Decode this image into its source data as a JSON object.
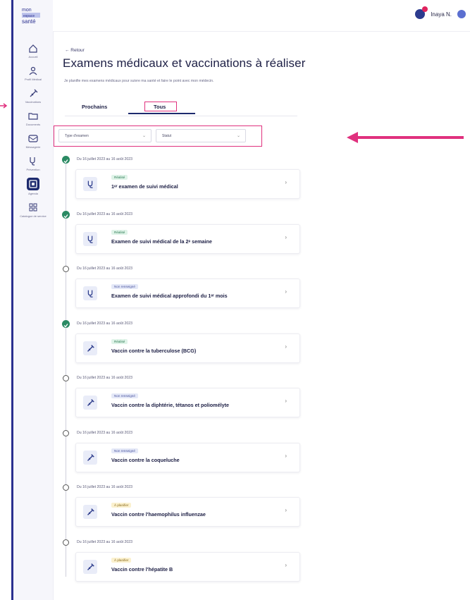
{
  "app": {
    "logo_text": [
      "mon",
      "espace",
      "santé"
    ],
    "user_name": "Inaya N."
  },
  "sidebar": {
    "items": [
      {
        "label": "Accueil",
        "icon": "home-icon"
      },
      {
        "label": "Profil Médical",
        "icon": "profile-icon"
      },
      {
        "label": "Vaccinations",
        "icon": "syringe-icon"
      },
      {
        "label": "Documents",
        "icon": "folder-icon"
      },
      {
        "label": "Messagerie",
        "icon": "mail-icon"
      },
      {
        "label": "Prévention",
        "icon": "stethoscope-icon"
      },
      {
        "label": "Agenda",
        "icon": "calendar-icon",
        "active": true
      },
      {
        "label": "Catalogue de service",
        "icon": "grid-icon"
      }
    ]
  },
  "page": {
    "back_label": "← Retour",
    "title": "Examens médicaux et vaccinations à réaliser",
    "subtitle": "Je planifie mes examens médicaux pour suivre ma santé et faire le point avec mon médecin."
  },
  "tabs": [
    {
      "label": "Prochains"
    },
    {
      "label": "Tous",
      "selected": true
    }
  ],
  "filters": [
    {
      "label": "Type d'examen"
    },
    {
      "label": "Statut"
    }
  ],
  "timeline": [
    {
      "date": "Du 16 juillet 2023 au 16 août 2023",
      "status": "Réalisé",
      "status_kind": "green",
      "title": "1ᵉʳ examen de suivi médical",
      "icon": "stethoscope-icon",
      "done": true
    },
    {
      "date": "Du 16 juillet 2023 au 16 août 2023",
      "status": "Réalisé",
      "status_kind": "green",
      "title": "Examen de suivi médical de la 2ᵉ semaine",
      "icon": "stethoscope-icon",
      "done": true
    },
    {
      "date": "Du 16 juillet 2023 au 16 août 2023",
      "status": "Non renseigné",
      "status_kind": "blue",
      "title": "Examen de suivi médical approfondi du 1ᵉʳ mois",
      "icon": "stethoscope-icon",
      "done": false
    },
    {
      "date": "Du 16 juillet 2023 au 16 août 2023",
      "status": "Réalisé",
      "status_kind": "green",
      "title": "Vaccin contre la tuberculose (BCG)",
      "icon": "syringe-icon",
      "done": true
    },
    {
      "date": "Du 16 juillet 2023 au 16 août 2023",
      "status": "Non renseigné",
      "status_kind": "blue",
      "title": "Vaccin contre la diphtérie, tétanos et poliomélyte",
      "icon": "syringe-icon",
      "done": false
    },
    {
      "date": "Du 16 juillet 2023 au 16 août 2023",
      "status": "Non renseigné",
      "status_kind": "blue",
      "title": "Vaccin contre la coqueluche",
      "icon": "syringe-icon",
      "done": false
    },
    {
      "date": "Du 16 juillet 2023 au 16 août 2023",
      "status": "À planifier",
      "status_kind": "yellow",
      "title": "Vaccin contre l'haemophilus influenzae",
      "icon": "syringe-icon",
      "done": false
    },
    {
      "date": "Du 16 juillet 2023 au 16 août 2023",
      "status": "À planifier",
      "status_kind": "yellow",
      "title": "Vaccin contre l'hépatite B",
      "icon": "syringe-icon",
      "done": false
    }
  ],
  "colors": {
    "brand": "#1d2a6e",
    "annotation": "#e0317e",
    "done": "#2a8a63"
  }
}
